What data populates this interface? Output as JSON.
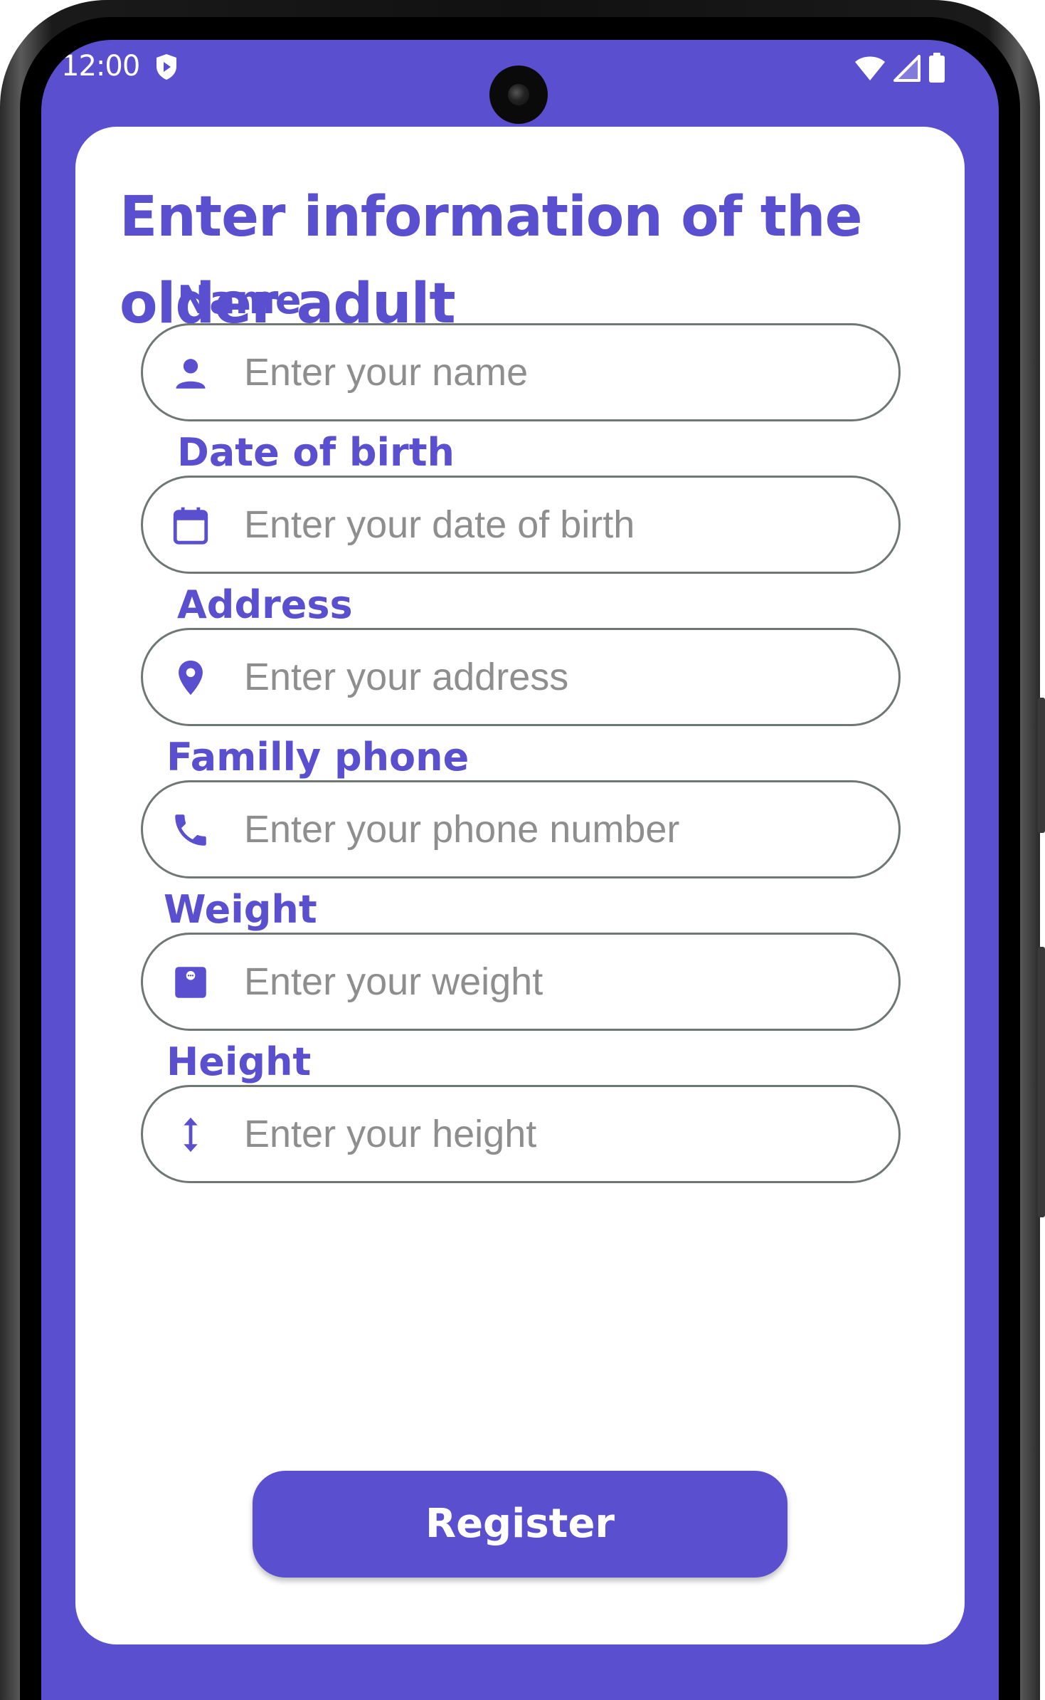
{
  "status_bar": {
    "time": "12:00"
  },
  "form": {
    "title": "Enter information of the older adult",
    "fields": [
      {
        "label": "Name",
        "placeholder": "Enter your name",
        "icon": "person-icon"
      },
      {
        "label": "Date of birth",
        "placeholder": "Enter your date of birth",
        "icon": "calendar-icon"
      },
      {
        "label": "Address",
        "placeholder": "Enter your address",
        "icon": "location-pin-icon"
      },
      {
        "label": "Familly phone",
        "placeholder": "Enter your phone number",
        "icon": "phone-icon"
      },
      {
        "label": "Weight",
        "placeholder": "Enter your weight",
        "icon": "scale-icon"
      },
      {
        "label": "Height",
        "placeholder": "Enter your height",
        "icon": "vertical-arrows-icon"
      }
    ],
    "register_label": "Register"
  },
  "colors": {
    "accent": "#5a4fcf",
    "placeholder": "#8e8e8e",
    "input_border": "#6f7774",
    "card": "#ffffff"
  }
}
